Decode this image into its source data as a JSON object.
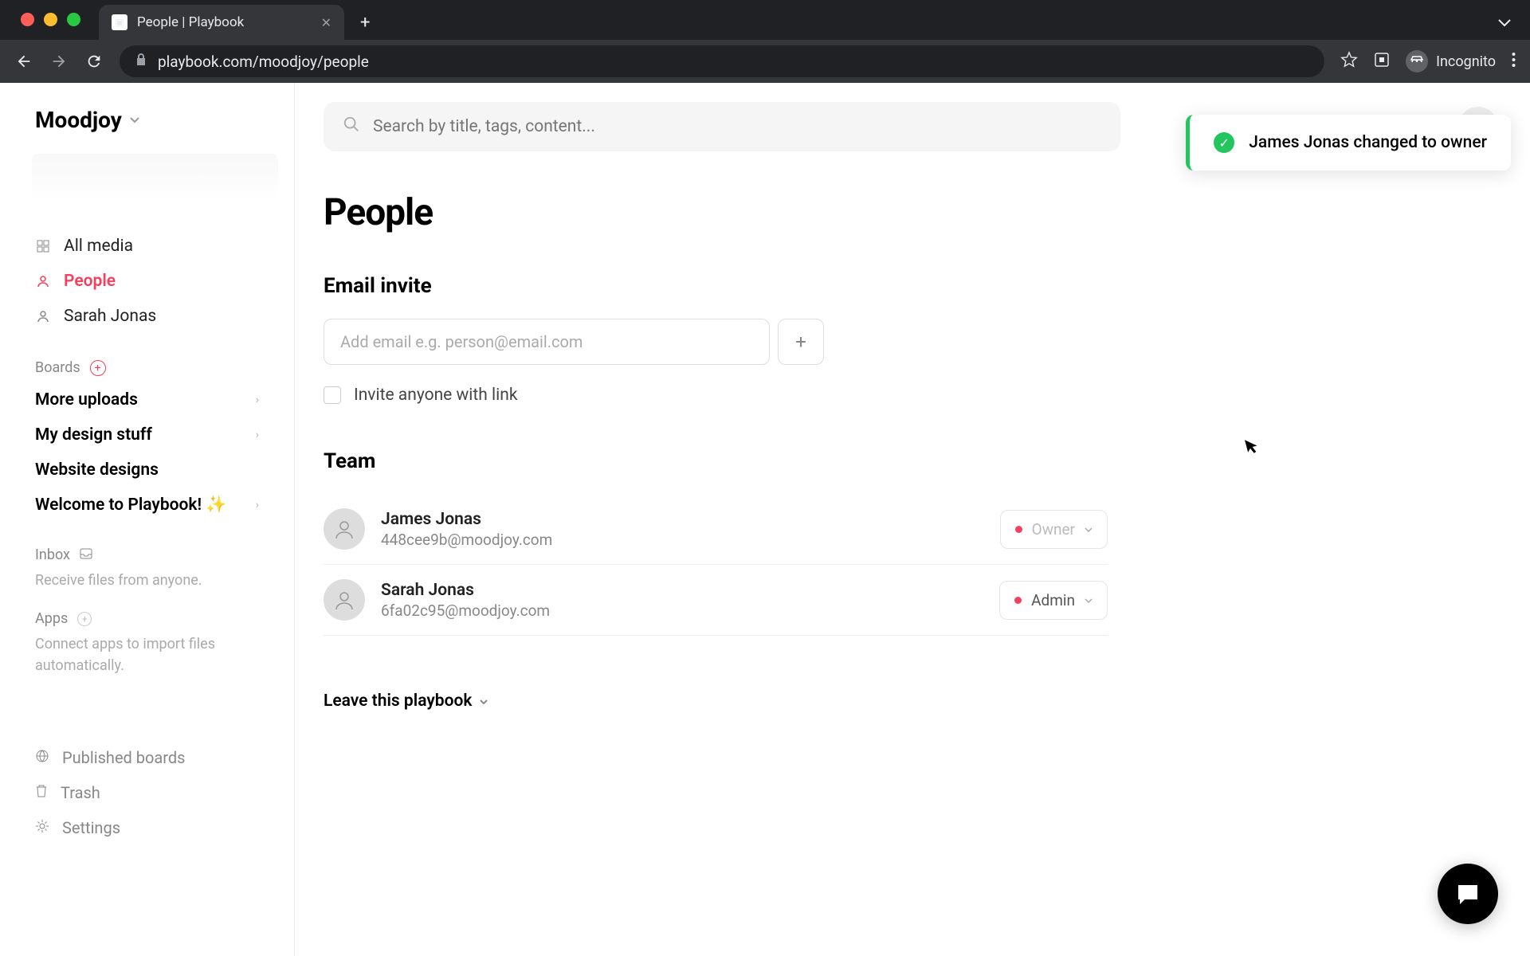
{
  "browser": {
    "tab_title": "People | Playbook",
    "url": "playbook.com/moodjoy/people",
    "incognito_label": "Incognito"
  },
  "workspace": {
    "name": "Moodjoy"
  },
  "sidebar": {
    "nav": {
      "all_media": "All media",
      "people": "People",
      "sarah": "Sarah Jonas"
    },
    "boards_label": "Boards",
    "boards": {
      "more_uploads": "More uploads",
      "design_stuff": "My design stuff",
      "website_designs": "Website designs",
      "welcome": "Welcome to Playbook! ✨"
    },
    "inbox_label": "Inbox",
    "inbox_sub": "Receive files from anyone.",
    "apps_label": "Apps",
    "apps_sub": "Connect apps to import files automatically.",
    "footer": {
      "published": "Published boards",
      "trash": "Trash",
      "settings": "Settings"
    }
  },
  "search": {
    "placeholder": "Search by title, tags, content..."
  },
  "toast": {
    "message": "James Jonas changed to owner"
  },
  "page": {
    "title": "People",
    "email_invite_title": "Email invite",
    "email_placeholder": "Add email e.g. person@email.com",
    "invite_link_label": "Invite anyone with link",
    "team_title": "Team",
    "leave_label": "Leave this playbook"
  },
  "team": [
    {
      "name": "James Jonas",
      "email": "448cee9b@moodjoy.com",
      "role": "Owner"
    },
    {
      "name": "Sarah Jonas",
      "email": "6fa02c95@moodjoy.com",
      "role": "Admin"
    }
  ]
}
